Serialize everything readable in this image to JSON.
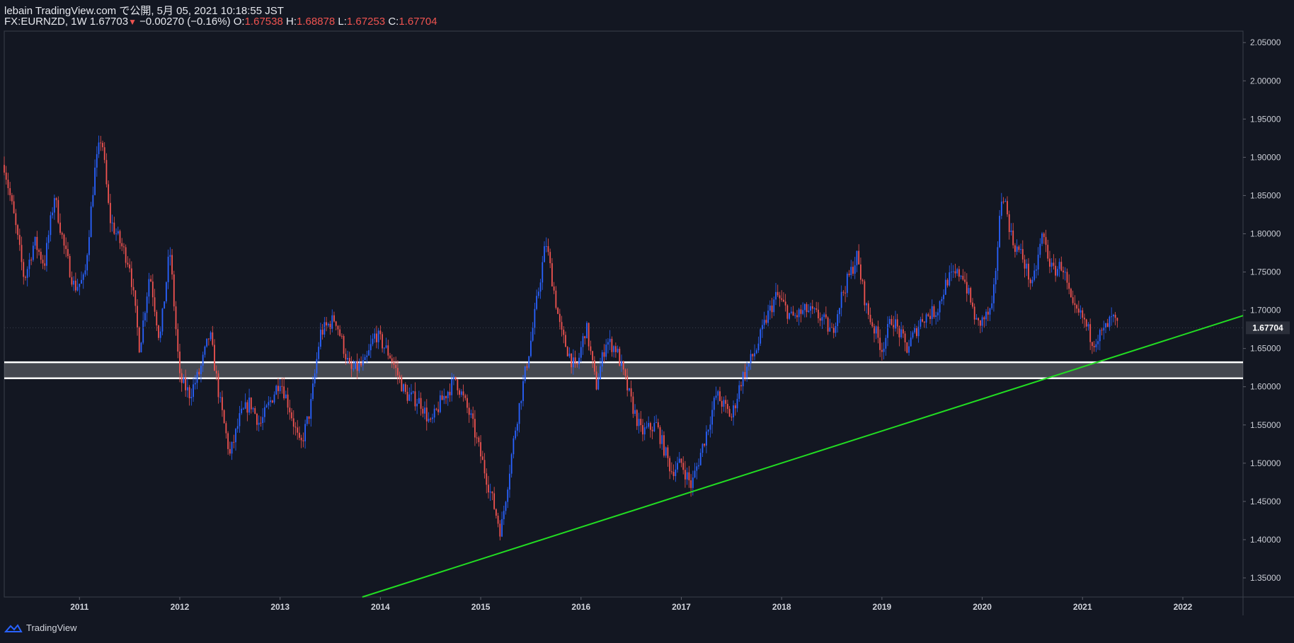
{
  "header": {
    "line1": "lebain TradingView.com で公開, 5月 05, 2021 10:18:55 JST",
    "symbol": "FX:EURNZD, 1W",
    "last": "1.67703",
    "change": "−0.00270 (−0.16%)",
    "o_label": "O:",
    "o_value": "1.67538",
    "h_label": "H:",
    "h_value": "1.68878",
    "l_label": "L:",
    "l_value": "1.67253",
    "c_label": "C:",
    "c_value": "1.67704"
  },
  "footer": {
    "brand": "TradingView"
  },
  "colors": {
    "background": "#131722",
    "up": "#2962ff",
    "down": "#ef5350",
    "trendline": "#22dd22",
    "zone": "#ffffff"
  },
  "chart_data": {
    "type": "candlestick",
    "symbol": "FX:EURNZD",
    "interval": "1W",
    "x_ticks": [
      "2011",
      "2012",
      "2013",
      "2014",
      "2015",
      "2016",
      "2017",
      "2018",
      "2019",
      "2020",
      "2021",
      "2022"
    ],
    "y_ticks": [
      "2.05000",
      "2.00000",
      "1.95000",
      "1.90000",
      "1.85000",
      "1.80000",
      "1.75000",
      "1.70000",
      "1.65000",
      "1.60000",
      "1.55000",
      "1.50000",
      "1.45000",
      "1.40000",
      "1.35000"
    ],
    "ylim": [
      1.325,
      2.065
    ],
    "xlim": [
      2010.25,
      2022.6
    ],
    "last_price_label": "1.67704",
    "series": [
      {
        "year": 2010.25,
        "price": 1.89
      },
      {
        "year": 2010.35,
        "price": 1.82
      },
      {
        "year": 2010.45,
        "price": 1.74
      },
      {
        "year": 2010.55,
        "price": 1.79
      },
      {
        "year": 2010.65,
        "price": 1.76
      },
      {
        "year": 2010.75,
        "price": 1.85
      },
      {
        "year": 2010.85,
        "price": 1.78
      },
      {
        "year": 2010.95,
        "price": 1.73
      },
      {
        "year": 2011.05,
        "price": 1.74
      },
      {
        "year": 2011.15,
        "price": 1.88
      },
      {
        "year": 2011.22,
        "price": 1.93
      },
      {
        "year": 2011.3,
        "price": 1.82
      },
      {
        "year": 2011.4,
        "price": 1.79
      },
      {
        "year": 2011.5,
        "price": 1.76
      },
      {
        "year": 2011.6,
        "price": 1.65
      },
      {
        "year": 2011.7,
        "price": 1.75
      },
      {
        "year": 2011.8,
        "price": 1.66
      },
      {
        "year": 2011.9,
        "price": 1.78
      },
      {
        "year": 2012.0,
        "price": 1.61
      },
      {
        "year": 2012.1,
        "price": 1.59
      },
      {
        "year": 2012.2,
        "price": 1.62
      },
      {
        "year": 2012.3,
        "price": 1.67
      },
      {
        "year": 2012.4,
        "price": 1.58
      },
      {
        "year": 2012.5,
        "price": 1.51
      },
      {
        "year": 2012.6,
        "price": 1.56
      },
      {
        "year": 2012.7,
        "price": 1.58
      },
      {
        "year": 2012.8,
        "price": 1.55
      },
      {
        "year": 2013.0,
        "price": 1.61
      },
      {
        "year": 2013.1,
        "price": 1.57
      },
      {
        "year": 2013.2,
        "price": 1.52
      },
      {
        "year": 2013.3,
        "price": 1.57
      },
      {
        "year": 2013.4,
        "price": 1.67
      },
      {
        "year": 2013.55,
        "price": 1.69
      },
      {
        "year": 2013.7,
        "price": 1.62
      },
      {
        "year": 2013.85,
        "price": 1.63
      },
      {
        "year": 2013.95,
        "price": 1.67
      },
      {
        "year": 2014.1,
        "price": 1.64
      },
      {
        "year": 2014.25,
        "price": 1.59
      },
      {
        "year": 2014.4,
        "price": 1.58
      },
      {
        "year": 2014.5,
        "price": 1.55
      },
      {
        "year": 2014.6,
        "price": 1.58
      },
      {
        "year": 2014.75,
        "price": 1.61
      },
      {
        "year": 2014.9,
        "price": 1.56
      },
      {
        "year": 2015.1,
        "price": 1.46
      },
      {
        "year": 2015.2,
        "price": 1.41
      },
      {
        "year": 2015.35,
        "price": 1.55
      },
      {
        "year": 2015.5,
        "price": 1.66
      },
      {
        "year": 2015.65,
        "price": 1.79
      },
      {
        "year": 2015.8,
        "price": 1.67
      },
      {
        "year": 2015.95,
        "price": 1.62
      },
      {
        "year": 2016.05,
        "price": 1.68
      },
      {
        "year": 2016.15,
        "price": 1.6
      },
      {
        "year": 2016.25,
        "price": 1.66
      },
      {
        "year": 2016.35,
        "price": 1.65
      },
      {
        "year": 2016.5,
        "price": 1.58
      },
      {
        "year": 2016.6,
        "price": 1.54
      },
      {
        "year": 2016.75,
        "price": 1.55
      },
      {
        "year": 2016.9,
        "price": 1.49
      },
      {
        "year": 2017.0,
        "price": 1.5
      },
      {
        "year": 2017.1,
        "price": 1.47
      },
      {
        "year": 2017.25,
        "price": 1.54
      },
      {
        "year": 2017.35,
        "price": 1.59
      },
      {
        "year": 2017.5,
        "price": 1.56
      },
      {
        "year": 2017.6,
        "price": 1.61
      },
      {
        "year": 2017.75,
        "price": 1.65
      },
      {
        "year": 2017.85,
        "price": 1.69
      },
      {
        "year": 2017.95,
        "price": 1.72
      },
      {
        "year": 2018.1,
        "price": 1.69
      },
      {
        "year": 2018.25,
        "price": 1.7
      },
      {
        "year": 2018.4,
        "price": 1.69
      },
      {
        "year": 2018.5,
        "price": 1.67
      },
      {
        "year": 2018.6,
        "price": 1.72
      },
      {
        "year": 2018.75,
        "price": 1.77
      },
      {
        "year": 2018.85,
        "price": 1.7
      },
      {
        "year": 2019.0,
        "price": 1.65
      },
      {
        "year": 2019.1,
        "price": 1.69
      },
      {
        "year": 2019.25,
        "price": 1.65
      },
      {
        "year": 2019.4,
        "price": 1.69
      },
      {
        "year": 2019.55,
        "price": 1.7
      },
      {
        "year": 2019.65,
        "price": 1.74
      },
      {
        "year": 2019.8,
        "price": 1.75
      },
      {
        "year": 2019.95,
        "price": 1.68
      },
      {
        "year": 2020.1,
        "price": 1.7
      },
      {
        "year": 2020.2,
        "price": 1.86
      },
      {
        "year": 2020.3,
        "price": 1.79
      },
      {
        "year": 2020.4,
        "price": 1.77
      },
      {
        "year": 2020.5,
        "price": 1.73
      },
      {
        "year": 2020.6,
        "price": 1.8
      },
      {
        "year": 2020.7,
        "price": 1.75
      },
      {
        "year": 2020.8,
        "price": 1.76
      },
      {
        "year": 2020.9,
        "price": 1.7
      },
      {
        "year": 2021.0,
        "price": 1.69
      },
      {
        "year": 2021.1,
        "price": 1.66
      },
      {
        "year": 2021.2,
        "price": 1.67
      },
      {
        "year": 2021.3,
        "price": 1.69
      },
      {
        "year": 2021.35,
        "price": 1.677
      }
    ],
    "trendline": {
      "from": {
        "year": 2013.82,
        "price": 1.325
      },
      "to": {
        "year": 2022.6,
        "price": 1.693
      }
    },
    "zone": {
      "top": 1.632,
      "bottom": 1.611
    }
  }
}
